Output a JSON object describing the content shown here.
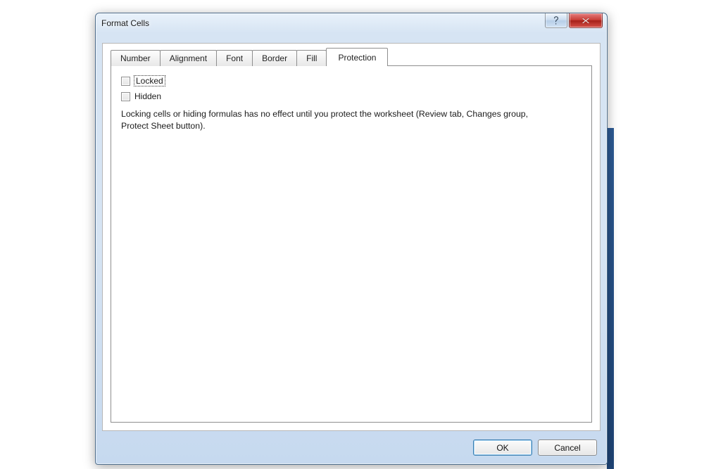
{
  "window": {
    "title": "Format Cells"
  },
  "tabs": {
    "number": {
      "label": "Number"
    },
    "alignment": {
      "label": "Alignment"
    },
    "font": {
      "label": "Font"
    },
    "border": {
      "label": "Border"
    },
    "fill": {
      "label": "Fill"
    },
    "protection": {
      "label": "Protection"
    }
  },
  "protection_tab": {
    "locked_label": "Locked",
    "locked_checked": false,
    "hidden_label": "Hidden",
    "hidden_checked": false,
    "help_text": "Locking cells or hiding formulas has no effect until you protect the worksheet (Review tab, Changes group, Protect Sheet button)."
  },
  "buttons": {
    "ok": "OK",
    "cancel": "Cancel"
  },
  "icons": {
    "help_glyph": "?",
    "close_glyph": "✕"
  }
}
